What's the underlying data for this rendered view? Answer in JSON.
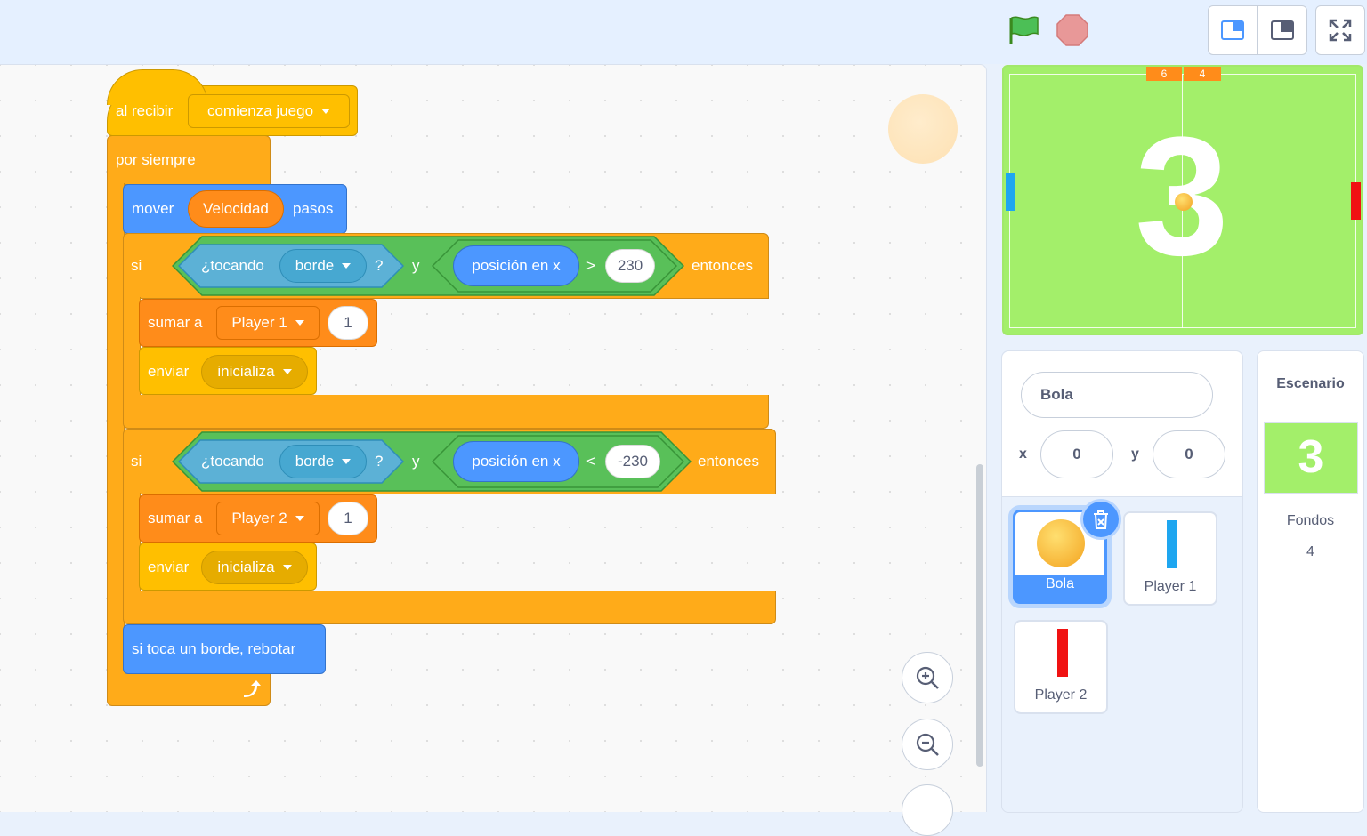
{
  "toolbar": {
    "green_flag": "green-flag-icon",
    "stop": "stop-icon",
    "small_stage_mode": "small-stage-icon",
    "normal_stage_mode": "normal-stage-icon",
    "fullscreen": "fullscreen-icon"
  },
  "script": {
    "hat_label": "al recibir",
    "hat_message": "comienza juego",
    "forever_label": "por siempre",
    "move_label": "mover",
    "move_var": "Velocidad",
    "move_suffix": "pasos",
    "if1": {
      "si": "si",
      "touching": "¿tocando",
      "touching_target": "borde",
      "q": "?",
      "and": "y",
      "reporter": "posición en x",
      "op": ">",
      "value": "230",
      "then": "entonces",
      "change_label": "sumar a",
      "change_var": "Player 1",
      "change_value": "1",
      "broadcast_label": "enviar",
      "broadcast_msg": "inicializa"
    },
    "if2": {
      "si": "si",
      "touching": "¿tocando",
      "touching_target": "borde",
      "q": "?",
      "and": "y",
      "reporter": "posición en x",
      "op": "<",
      "value": "-230",
      "then": "entonces",
      "change_label": "sumar a",
      "change_var": "Player 2",
      "change_value": "1",
      "broadcast_label": "enviar",
      "broadcast_msg": "inicializa"
    },
    "bounce_label": "si toca un borde, rebotar"
  },
  "stage": {
    "score_left": "6",
    "score_right": "4",
    "big_number": "3",
    "colors": {
      "field": "#a3ef6a",
      "paddle_left": "#1ea6f0",
      "paddle_right": "#f01212"
    }
  },
  "sprite_info": {
    "name": "Bola",
    "x_label": "x",
    "x_value": "0",
    "y_label": "y",
    "y_value": "0"
  },
  "sprites": [
    {
      "name": "Bola",
      "selected": true
    },
    {
      "name": "Player 1",
      "selected": false
    },
    {
      "name": "Player 2",
      "selected": false
    }
  ],
  "stage_panel": {
    "title": "Escenario",
    "backdrop_number": "3",
    "backdrops_label": "Fondos",
    "backdrops_count": "4"
  }
}
